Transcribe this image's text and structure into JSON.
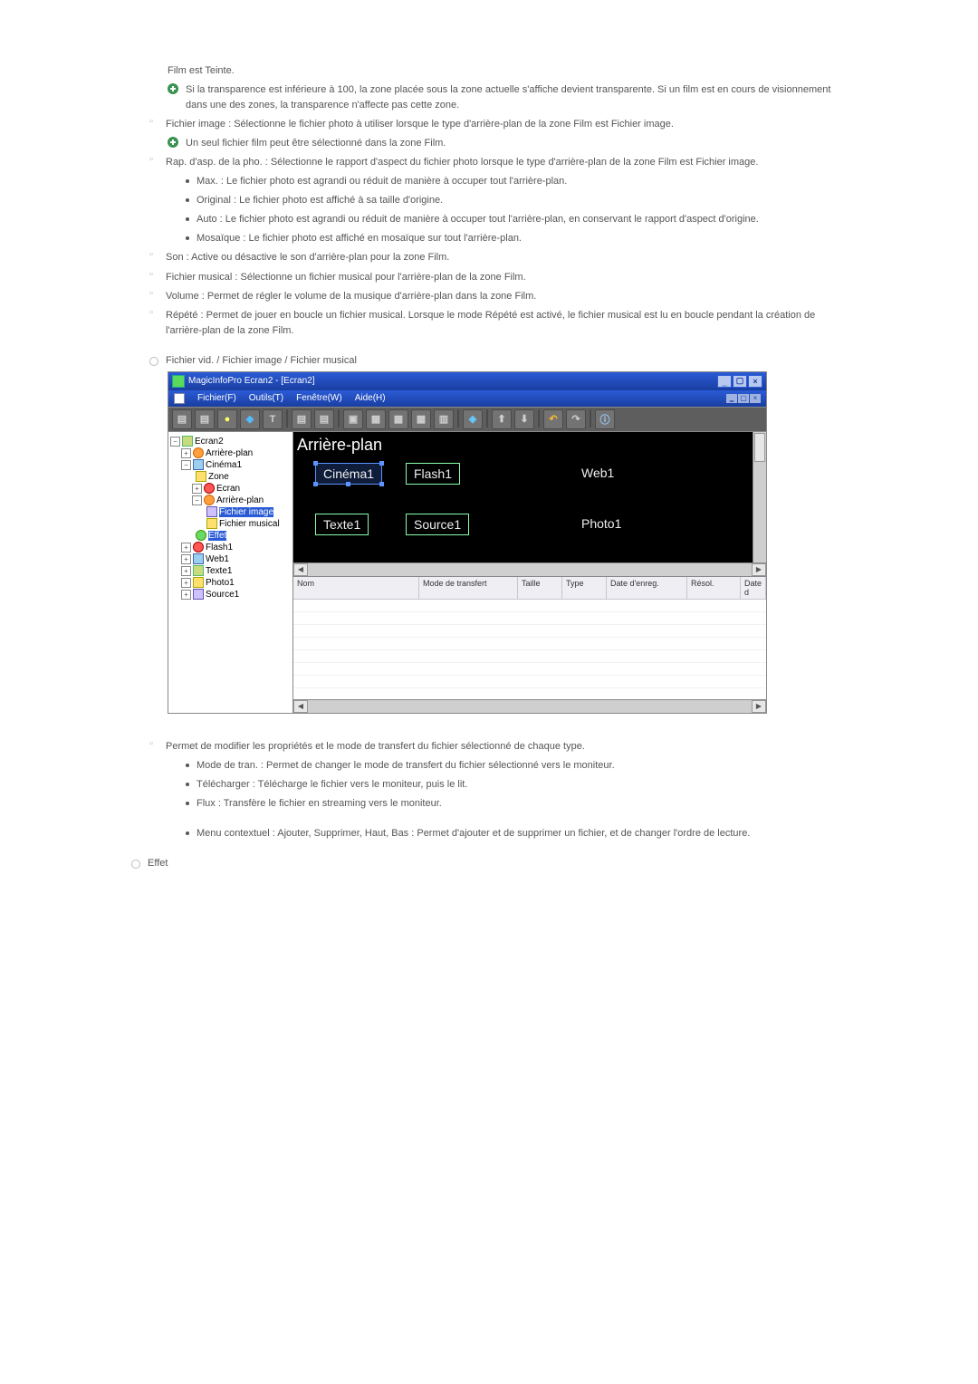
{
  "doc": {
    "p_teinte": "Film est Teinte.",
    "p_transp": "Si la transparence est inférieure à 100, la zone placée sous la zone actuelle s'affiche devient transparente. Si un film est en cours de visionnement dans une des zones, la transparence n'affecte pas cette zone.",
    "p_fichier_image": "Fichier image : Sélectionne le fichier photo à utiliser lorsque le type d'arrière-plan de la zone Film est Fichier image.",
    "p_un_seul": "Un seul fichier film peut être sélectionné dans la zone Film.",
    "p_rap": "Rap. d'asp. de la pho. : Sélectionne le rapport d'aspect du fichier photo lorsque le type d'arrière-plan de la zone Film est Fichier image.",
    "p_max": "Max. : Le fichier photo est agrandi ou réduit de manière à occuper tout l'arrière-plan.",
    "p_original": "Original : Le fichier photo est affiché à sa taille d'origine.",
    "p_auto": "Auto : Le fichier photo est agrandi ou réduit de manière à occuper tout l'arrière-plan, en conservant le rapport d'aspect d'origine.",
    "p_mosaique": "Mosaïque : Le fichier photo est affiché en mosaïque sur tout l'arrière-plan.",
    "p_son": "Son : Active ou désactive le son d'arrière-plan pour la zone Film.",
    "p_fichier_musical": "Fichier musical : Sélectionne un fichier musical pour l'arrière-plan de la zone Film.",
    "p_volume": "Volume : Permet de régler le volume de la musique d'arrière-plan dans la zone Film.",
    "p_repete": "Répété : Permet de jouer en boucle un fichier musical. Lorsque le mode Répété est activé, le fichier musical est lu en boucle pendant la création de l'arrière-plan de la zone Film.",
    "h_fvid": "Fichier vid. / Fichier image / Fichier musical",
    "p_permet": "Permet de modifier les propriétés et le mode de transfert du fichier sélectionné de chaque type.",
    "p_mode": "Mode de tran. : Permet de changer le mode de transfert du fichier sélectionné vers le moniteur.",
    "p_telech": "Télécharger : Télécharge le fichier vers le moniteur, puis le lit.",
    "p_flux": "Flux : Transfère le fichier en streaming vers le moniteur.",
    "p_menu": "Menu contextuel : Ajouter, Supprimer, Haut, Bas : Permet d'ajouter et de supprimer un fichier, et de changer l'ordre de lecture.",
    "h_effet": "Effet"
  },
  "app": {
    "title": "MagicInfoPro Ecran2 - [Ecran2]",
    "menus": [
      "Fichier(F)",
      "Outils(T)",
      "Fenêtre(W)",
      "Aide(H)"
    ],
    "canvas_title": "Arrière-plan",
    "tree": {
      "n0": "Ecran2",
      "n1": "Arrière-plan",
      "n2": "Cinéma1",
      "n3": "Zone",
      "n4": "Ecran",
      "n5": "Arrière-plan",
      "n6": "Fichier image",
      "n7": "Fichier musical",
      "n8": "Effet",
      "n9": "Flash1",
      "n10": "Web1",
      "n11": "Texte1",
      "n12": "Photo1",
      "n13": "Source1"
    },
    "zones": {
      "cinema": "Cinéma1",
      "flash": "Flash1",
      "web": "Web1",
      "texte": "Texte1",
      "source": "Source1",
      "photo": "Photo1"
    },
    "grid": {
      "c1": "Nom",
      "c2": "Mode de transfert",
      "c3": "Taille",
      "c4": "Type",
      "c5": "Date d'enreg.",
      "c6": "Résol.",
      "c7": "Date d"
    }
  }
}
